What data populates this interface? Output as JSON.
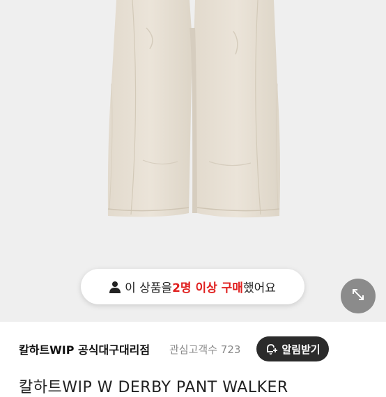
{
  "product": {
    "image_alt": "Carhartt WIP W Derby Pant Walker in beige",
    "title": "칼하트WIP W DERBY PANT WALKER"
  },
  "purchase_notice": {
    "prefix": "이 상품을 ",
    "highlight": "2명 이상 구매",
    "suffix": " 했어요",
    "highlight_color": "#e0201f"
  },
  "store": {
    "name": "칼하트WIP 공식대구대리점",
    "followers_label": "관심고객수",
    "followers_count": "723",
    "notify_label": "알림받기"
  },
  "icons": {
    "person": "person-icon",
    "expand": "expand-arrows-icon",
    "bell": "bell-plus-icon"
  }
}
